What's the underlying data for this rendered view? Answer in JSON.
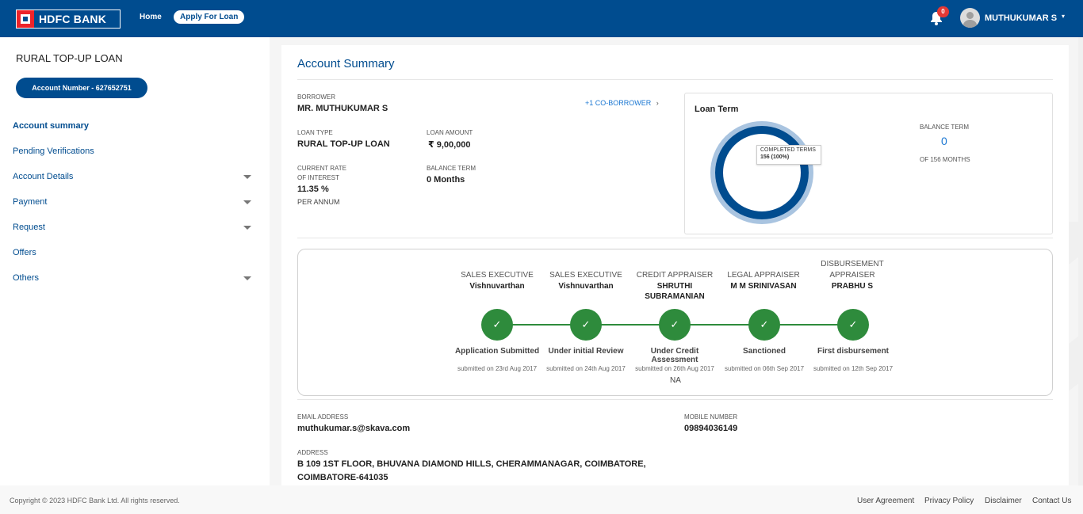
{
  "header": {
    "bank_name": "HDFC BANK",
    "nav_home": "Home",
    "nav_apply": "Apply For Loan",
    "notifications_count": "0",
    "username": "MUTHUKUMAR S",
    "user_caret": "▾"
  },
  "sidebar": {
    "product_title": "RURAL TOP-UP LOAN",
    "account_button": "Account Number - 627652751",
    "items": [
      {
        "label": "Account summary",
        "active": true,
        "expandable": false
      },
      {
        "label": "Pending Verifications",
        "active": false,
        "expandable": false
      },
      {
        "label": "Account Details",
        "active": false,
        "expandable": true
      },
      {
        "label": "Payment",
        "active": false,
        "expandable": true
      },
      {
        "label": "Request",
        "active": false,
        "expandable": true
      },
      {
        "label": "Offers",
        "active": false,
        "expandable": false
      },
      {
        "label": "Others",
        "active": false,
        "expandable": true
      }
    ]
  },
  "summary": {
    "title": "Account Summary",
    "borrower_label": "BORROWER",
    "borrower_value": "MR. MUTHUKUMAR S",
    "co_borrower_link": "+1 CO-BORROWER",
    "co_borrower_caret": "›",
    "loan_type_label": "LOAN TYPE",
    "loan_type_value": "RURAL TOP-UP LOAN",
    "loan_amount_label": "LOAN AMOUNT",
    "loan_amount_value": "₹ 9,00,000",
    "rate_label_1": "CURRENT RATE",
    "rate_label_2": "OF INTEREST",
    "rate_value": "11.35 %",
    "rate_unit": "PER ANNUM",
    "balance_term_label": "BALANCE TERM",
    "balance_term_value": "0 Months"
  },
  "loan_term": {
    "title": "Loan Term",
    "tooltip_label": "COMPLETED TERMS",
    "tooltip_value": "156 (100%)",
    "completed_fraction": 1.0,
    "balance_label": "BALANCE TERM",
    "balance_value": "0",
    "of_months": "OF 156 MONTHS",
    "colors": {
      "completed": "#004c8f",
      "outer": "#a9c4e0"
    }
  },
  "tracker": {
    "stages": [
      {
        "role": "SALES EXECUTIVE",
        "person": "Vishnuvarthan",
        "step": "Application Submitted",
        "date": "submitted on 23rd Aug 2017",
        "check": "✓"
      },
      {
        "role": "SALES EXECUTIVE",
        "person": "Vishnuvarthan",
        "step": "Under initial Review",
        "date": "submitted on 24th Aug 2017",
        "check": "✓"
      },
      {
        "role": "CREDIT APPRAISER",
        "person": "SHRUTHI SUBRAMANIAN",
        "step": "Under Credit Assessment",
        "date": "submitted on 26th Aug 2017",
        "check": "✓"
      },
      {
        "role": "LEGAL APPRAISER",
        "person": "M M SRINIVASAN",
        "step": "Sanctioned",
        "date": "submitted on 06th Sep 2017",
        "check": "✓"
      },
      {
        "role": "DISBURSEMENT APPRAISER",
        "person": "PRABHU S",
        "step": "First disbursement",
        "date": "submitted on 12th Sep 2017",
        "check": "✓"
      }
    ],
    "na_text": "NA",
    "color": "#2e8b3c"
  },
  "contact": {
    "email_label": "EMAIL ADDRESS",
    "email_value": "muthukumar.s@skava.com",
    "mobile_label": "MOBILE NUMBER",
    "mobile_value": "09894036149",
    "address_label": "ADDRESS",
    "address_line1": "B 109 1ST FLOOR, BHUVANA DIAMOND HILLS, CHERAMMANAGAR, COIMBATORE,",
    "address_line2": "COIMBATORE-641035"
  },
  "footer": {
    "copyright": "Copyright © 2023 HDFC Bank Ltd. All rights reserved.",
    "links": [
      "User Agreement",
      "Privacy Policy",
      "Disclaimer",
      "Contact Us"
    ]
  },
  "colors": {
    "brand_blue": "#004c8f",
    "brand_red": "#ed232a",
    "link_blue": "#1976d2"
  }
}
